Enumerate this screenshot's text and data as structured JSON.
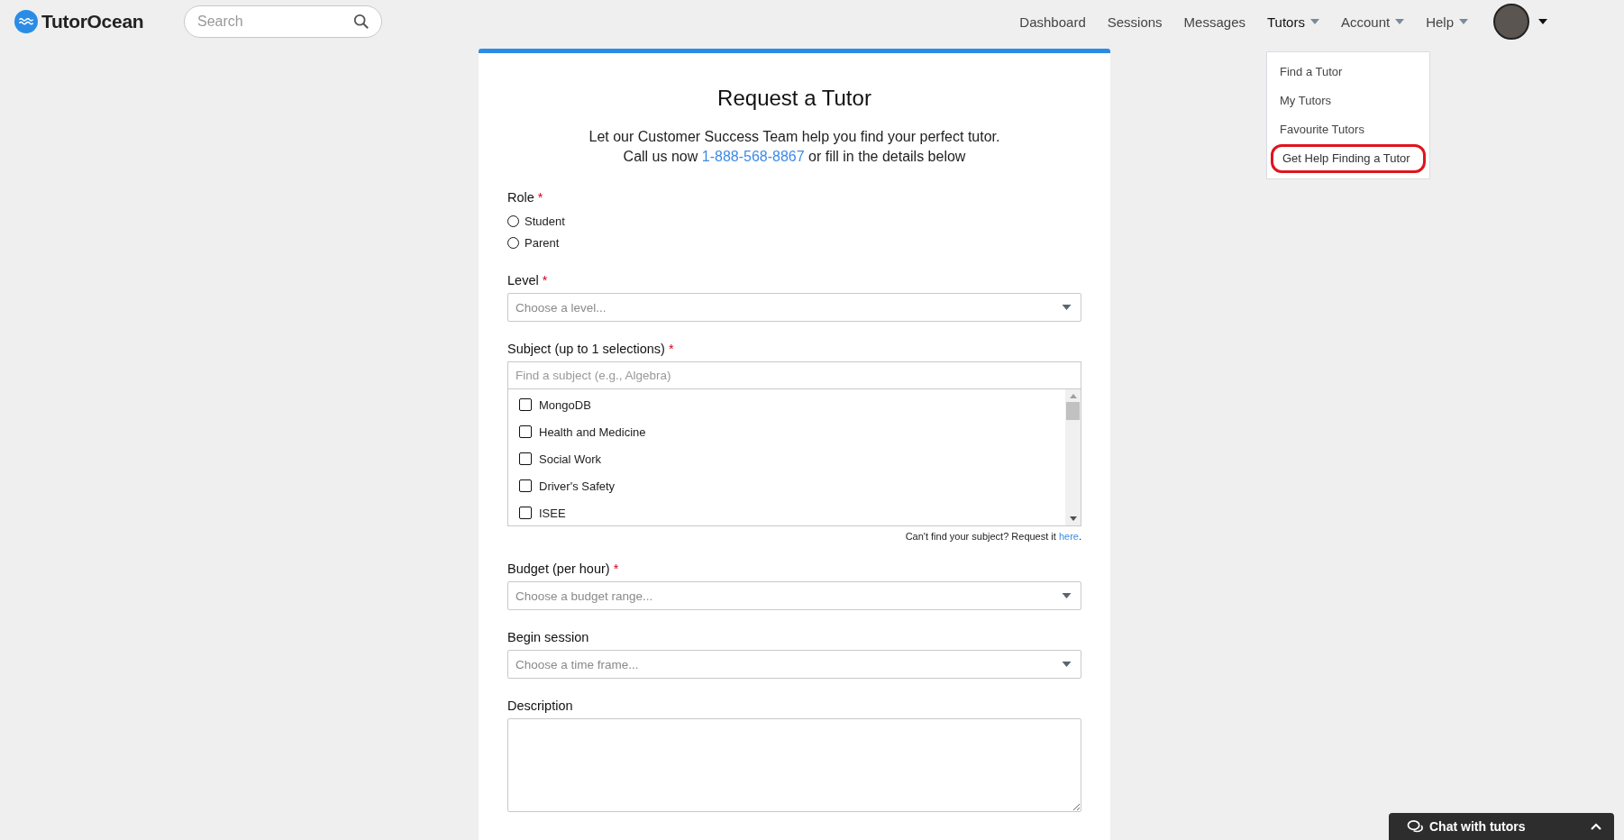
{
  "header": {
    "logo": "TutorOcean",
    "search": {
      "placeholder": "Search"
    },
    "nav": [
      {
        "label": "Dashboard",
        "has_menu": false,
        "selected": false
      },
      {
        "label": "Sessions",
        "has_menu": false,
        "selected": false
      },
      {
        "label": "Messages",
        "has_menu": false,
        "selected": false
      },
      {
        "label": "Tutors",
        "has_menu": true,
        "selected": true
      },
      {
        "label": "Account",
        "has_menu": true,
        "selected": false
      },
      {
        "label": "Help",
        "has_menu": true,
        "selected": false
      }
    ]
  },
  "tutors_menu": [
    {
      "label": "Find a Tutor",
      "circled": false
    },
    {
      "label": "My Tutors",
      "circled": false
    },
    {
      "label": "Favourite Tutors",
      "circled": false
    },
    {
      "label": "Get Help Finding a Tutor",
      "circled": true
    }
  ],
  "form": {
    "title": "Request a Tutor",
    "intro": "Let our Customer Success Team help you find your perfect tutor.",
    "call_before": "Call us now",
    "phone": "1-888-568-8867",
    "call_after": "or fill in the details below",
    "fields": [
      {
        "kind": "radio",
        "label": "Role",
        "required_mark": "*",
        "options": [
          {
            "label": "Student",
            "selected": false
          },
          {
            "label": "Parent",
            "selected": false
          }
        ]
      },
      {
        "kind": "select",
        "label": "Level",
        "required_mark": "*",
        "placeholder": "Choose a level..."
      },
      {
        "kind": "checklist",
        "label": "Subject (up to 1 selections)",
        "required_mark": "*",
        "placeholder": "Find a subject (e.g., Algebra)",
        "options": [
          {
            "label": "MongoDB",
            "checked": false
          },
          {
            "label": "Health and Medicine",
            "checked": false
          },
          {
            "label": "Social Work",
            "checked": false
          },
          {
            "label": "Driver's Safety",
            "checked": false
          },
          {
            "label": "ISEE",
            "checked": false
          }
        ],
        "note": "Can't find your subject? Request it",
        "note_link": "here",
        "note_end": "."
      },
      {
        "kind": "select",
        "label": "Budget (per hour)",
        "required_mark": "*",
        "placeholder": "Choose a budget range..."
      },
      {
        "kind": "select",
        "label": "Begin session",
        "placeholder": "Choose a time frame..."
      },
      {
        "kind": "textarea",
        "label": "Description"
      }
    ]
  },
  "chat": {
    "label": "Chat with tutors"
  }
}
